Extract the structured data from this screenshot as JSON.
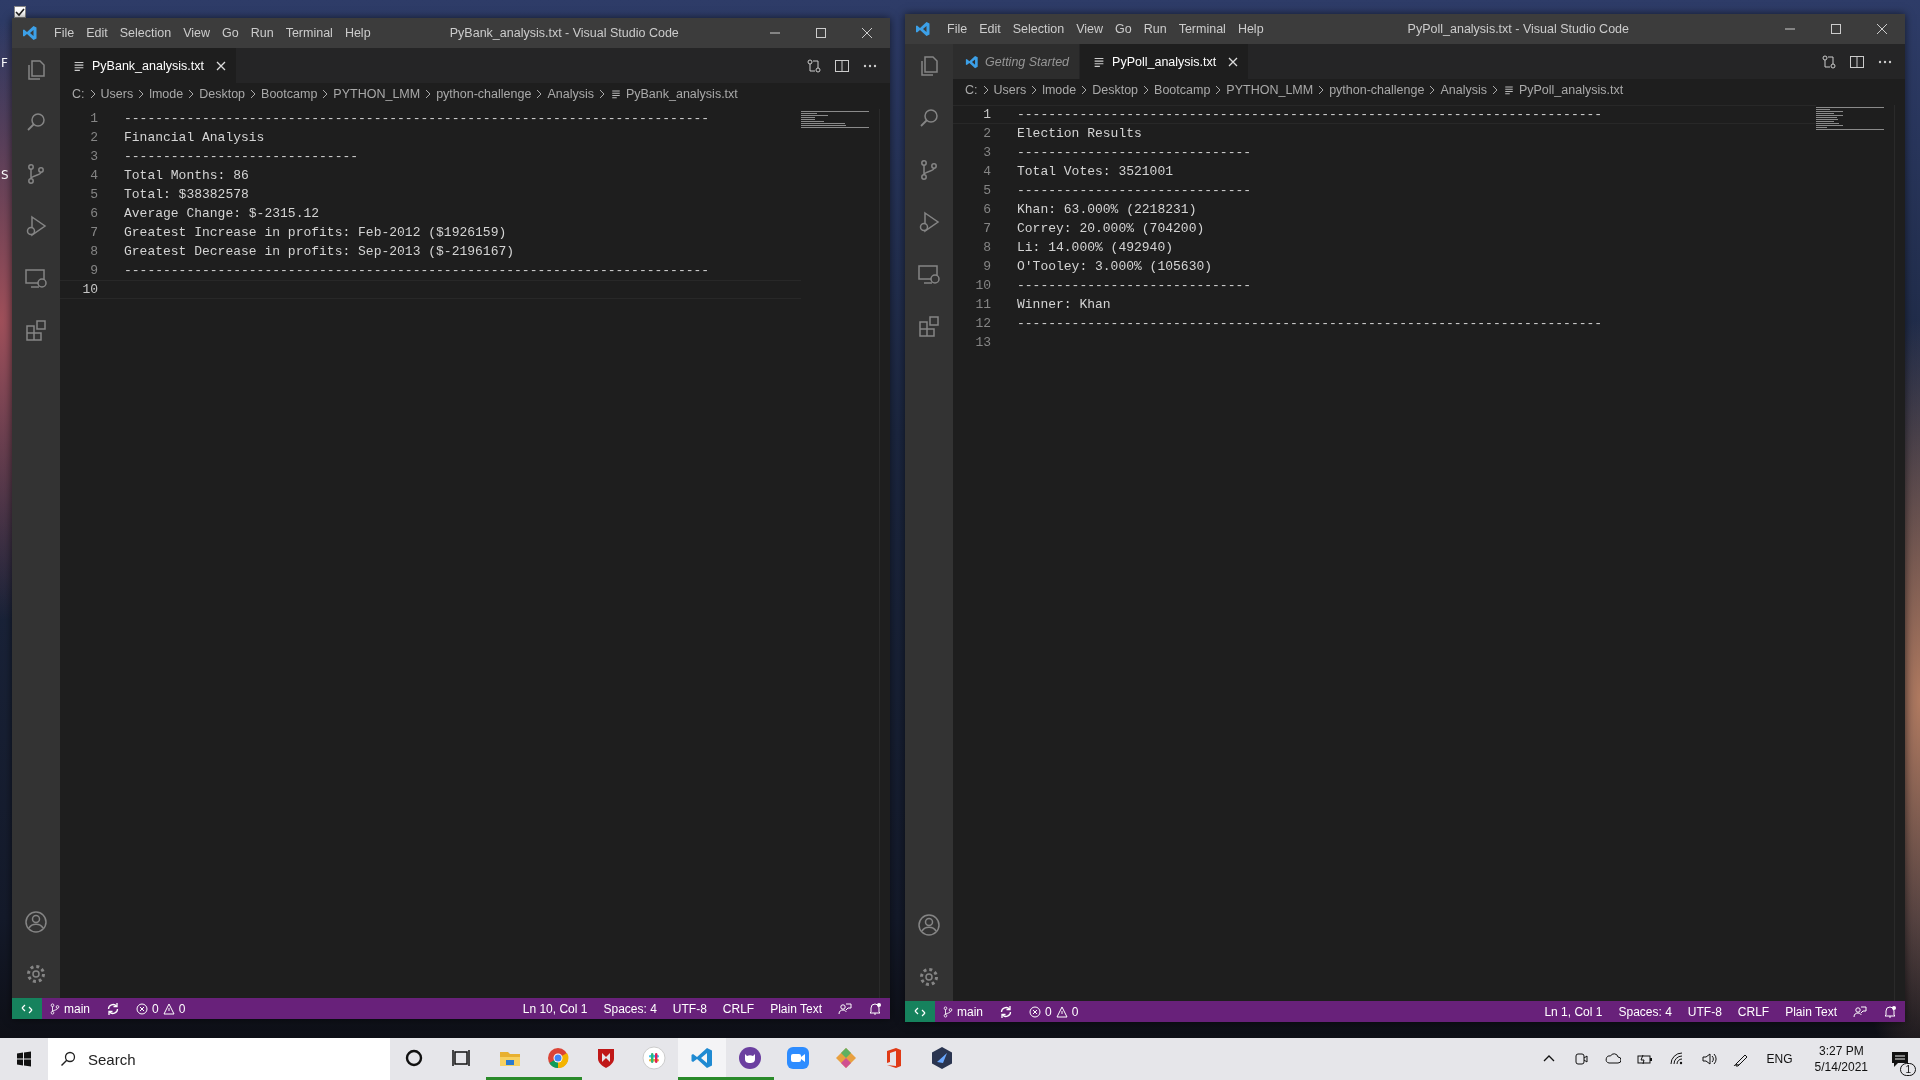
{
  "desktop_fragments": [
    "F",
    "S"
  ],
  "windows": [
    {
      "title": "PyBank_analysis.txt - Visual Studio Code",
      "menu": [
        "File",
        "Edit",
        "Selection",
        "View",
        "Go",
        "Run",
        "Terminal",
        "Help"
      ],
      "tabs": [
        {
          "label": "PyBank_analysis.txt",
          "kind": "file",
          "selected": true,
          "preview": false
        }
      ],
      "breadcrumbs": [
        "C:",
        "Users",
        "lmode",
        "Desktop",
        "Bootcamp",
        "PYTHON_LMM",
        "python-challenge",
        "Analysis",
        "PyBank_analysis.txt"
      ],
      "lines": [
        {
          "n": "1",
          "text": "---------------------------------------------------------------------------",
          "active": false
        },
        {
          "n": "2",
          "text": "Financial Analysis",
          "active": false
        },
        {
          "n": "3",
          "text": "------------------------------",
          "active": false
        },
        {
          "n": "4",
          "text": "Total Months: 86",
          "active": false
        },
        {
          "n": "5",
          "text": "Total: $38382578",
          "active": false
        },
        {
          "n": "6",
          "text": "Average Change: $-2315.12",
          "active": false
        },
        {
          "n": "7",
          "text": "Greatest Increase in profits: Feb-2012 ($1926159)",
          "active": false
        },
        {
          "n": "8",
          "text": "Greatest Decrease in profits: Sep-2013 ($-2196167)",
          "active": false
        },
        {
          "n": "9",
          "text": "---------------------------------------------------------------------------",
          "active": false
        },
        {
          "n": "10",
          "active": true
        }
      ],
      "status": {
        "branch": "main",
        "errors": "0",
        "warnings": "0",
        "items": [
          "Ln 10, Col 1",
          "Spaces: 4",
          "UTF-8",
          "CRLF",
          "Plain Text"
        ]
      }
    },
    {
      "title": "PyPoll_analysis.txt - Visual Studio Code",
      "menu": [
        "File",
        "Edit",
        "Selection",
        "View",
        "Go",
        "Run",
        "Terminal",
        "Help"
      ],
      "tabs": [
        {
          "label": "Getting Started",
          "kind": "welcome",
          "selected": false,
          "preview": true
        },
        {
          "label": "PyPoll_analysis.txt",
          "kind": "file",
          "selected": true,
          "preview": false
        }
      ],
      "breadcrumbs": [
        "C:",
        "Users",
        "lmode",
        "Desktop",
        "Bootcamp",
        "PYTHON_LMM",
        "python-challenge",
        "Analysis",
        "PyPoll_analysis.txt"
      ],
      "lines": [
        {
          "n": "1",
          "text": "---------------------------------------------------------------------------",
          "active": true
        },
        {
          "n": "2",
          "text": "Election Results",
          "active": false
        },
        {
          "n": "3",
          "text": "------------------------------",
          "active": false
        },
        {
          "n": "4",
          "text": "Total Votes: 3521001",
          "active": false
        },
        {
          "n": "5",
          "text": "------------------------------",
          "active": false
        },
        {
          "n": "6",
          "text": "Khan: 63.000% (2218231)",
          "active": false
        },
        {
          "n": "7",
          "text": "Correy: 20.000% (704200)",
          "active": false
        },
        {
          "n": "8",
          "text": "Li: 14.000% (492940)",
          "active": false
        },
        {
          "n": "9",
          "text": "O'Tooley: 3.000% (105630)",
          "active": false
        },
        {
          "n": "10",
          "text": "------------------------------",
          "active": false
        },
        {
          "n": "11",
          "text": "Winner: Khan",
          "active": false
        },
        {
          "n": "12",
          "text": "---------------------------------------------------------------------------",
          "active": false
        },
        {
          "n": "13",
          "active": false
        }
      ],
      "status": {
        "branch": "main",
        "errors": "0",
        "warnings": "0",
        "items": [
          "Ln 1, Col 1",
          "Spaces: 4",
          "UTF-8",
          "CRLF",
          "Plain Text"
        ]
      }
    }
  ],
  "taskbar": {
    "search": {
      "placeholder": "Search"
    },
    "apps": [
      {
        "kind": "cortana",
        "running": false,
        "selected": false
      },
      {
        "kind": "taskview",
        "running": false,
        "selected": false
      },
      {
        "kind": "folder",
        "running": true,
        "selected": false
      },
      {
        "kind": "chrome",
        "running": true,
        "selected": false
      },
      {
        "kind": "shield",
        "running": false,
        "selected": false
      },
      {
        "kind": "slack",
        "running": false,
        "selected": false
      },
      {
        "kind": "vscode",
        "running": true,
        "selected": true
      },
      {
        "kind": "github",
        "running": true,
        "selected": false
      },
      {
        "kind": "zoom",
        "running": false,
        "selected": false
      },
      {
        "kind": "diamond",
        "running": false,
        "selected": false
      },
      {
        "kind": "office",
        "running": false,
        "selected": false
      },
      {
        "kind": "hexagon",
        "running": false,
        "selected": false
      }
    ],
    "language": "ENG",
    "time": "3:27 PM",
    "date": "5/14/2021",
    "notifications": "1"
  }
}
